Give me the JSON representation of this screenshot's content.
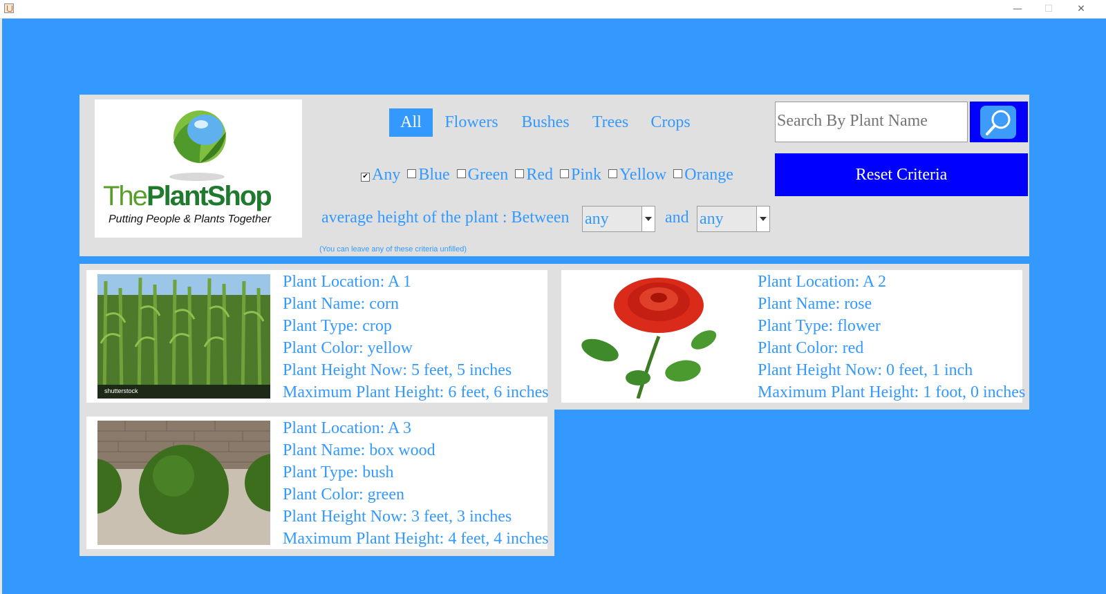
{
  "window": {
    "minimize_glyph": "—",
    "maximize_glyph": "☐",
    "close_glyph": "✕"
  },
  "logo": {
    "text_part1": "The",
    "text_part2": "Plant",
    "text_part3": "Shop",
    "tagline": "Putting People & Plants Together"
  },
  "tabs": [
    {
      "label": "All",
      "active": true
    },
    {
      "label": "Flowers",
      "active": false
    },
    {
      "label": "Bushes",
      "active": false
    },
    {
      "label": "Trees",
      "active": false
    },
    {
      "label": "Crops",
      "active": false
    }
  ],
  "colors": [
    {
      "label": "Any",
      "checked": true
    },
    {
      "label": "Blue",
      "checked": false
    },
    {
      "label": "Green",
      "checked": false
    },
    {
      "label": "Red",
      "checked": false
    },
    {
      "label": "Pink",
      "checked": false
    },
    {
      "label": "Yellow",
      "checked": false
    },
    {
      "label": "Orange",
      "checked": false
    }
  ],
  "height_filter": {
    "label": "average height of the plant :  Between",
    "and_label": "and",
    "min_value": "any",
    "max_value": "any"
  },
  "hint": "(You can leave any of these criteria unfilled)",
  "search": {
    "placeholder": "Search By Plant Name"
  },
  "reset_label": "Reset Criteria",
  "plants": [
    {
      "location": "Plant Location: A 1",
      "name": "Plant Name: corn",
      "type": "Plant Type: crop",
      "color": "Plant Color: yellow",
      "height_now": "Plant Height Now: 5 feet, 5 inches",
      "max_height": "Maximum Plant Height: 6 feet, 6 inches",
      "watermark": "shutterstock"
    },
    {
      "location": "Plant Location: A 2",
      "name": "Plant Name: rose",
      "type": "Plant Type: flower",
      "color": "Plant Color: red",
      "height_now": "Plant Height Now: 0 feet, 1 inch",
      "max_height": "Maximum Plant Height: 1 foot, 0 inches"
    },
    {
      "location": "Plant Location: A 3",
      "name": "Plant Name: box wood",
      "type": "Plant Type: bush",
      "color": "Plant Color: green",
      "height_now": "Plant Height Now: 3 feet, 3 inches",
      "max_height": "Maximum Plant Height: 4 feet, 4 inches"
    }
  ],
  "theme": {
    "background": "#3399ff",
    "panel": "#e0e0e0",
    "accent_blue": "#0000ff",
    "text_blue": "#3399ff"
  }
}
